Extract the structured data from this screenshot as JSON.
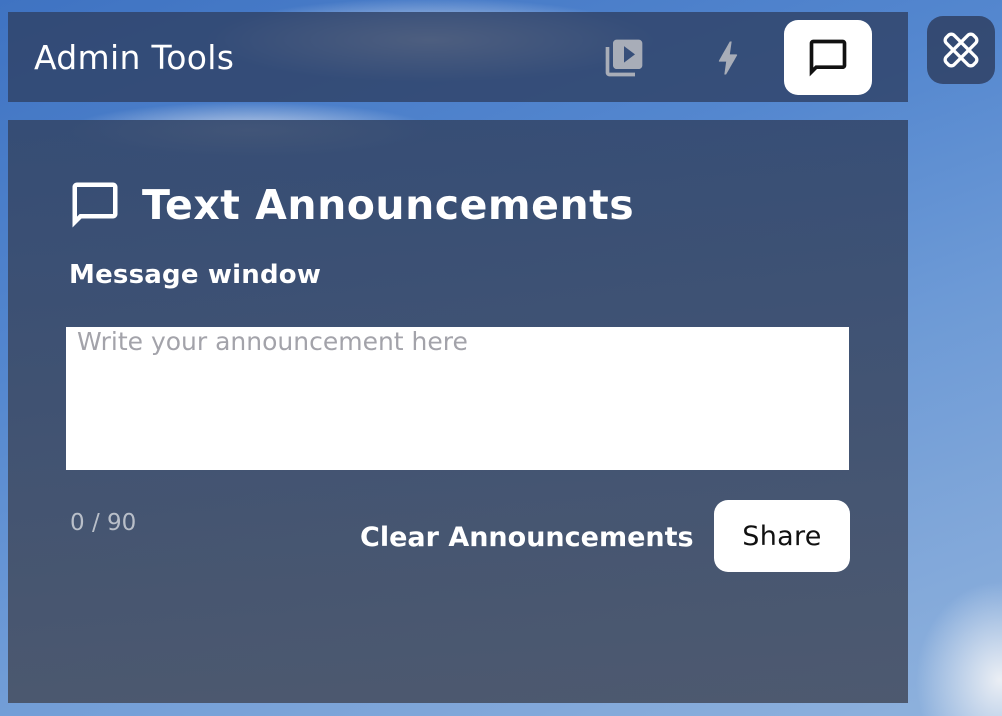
{
  "header": {
    "title": "Admin Tools",
    "buttons": [
      {
        "icon": "video-library-icon",
        "active": false
      },
      {
        "icon": "bolt-icon",
        "active": false
      },
      {
        "icon": "chat-bubble-icon",
        "active": true
      }
    ]
  },
  "side_button": {
    "icon": "tools-icon"
  },
  "panel": {
    "icon": "chat-bubble-icon",
    "title": "Text Announcements",
    "field_label": "Message window",
    "input": {
      "value": "",
      "placeholder": "Write your announcement here"
    },
    "char_count": "0 / 90",
    "clear_label": "Clear Announcements",
    "share_label": "Share"
  },
  "colors": {
    "panel_bg": "#34486c",
    "header_bg": "#304266",
    "active_button_bg": "#ffffff",
    "inactive_icon": "#a8adb8",
    "text_primary": "#ffffff",
    "placeholder": "#a3a3aa"
  }
}
